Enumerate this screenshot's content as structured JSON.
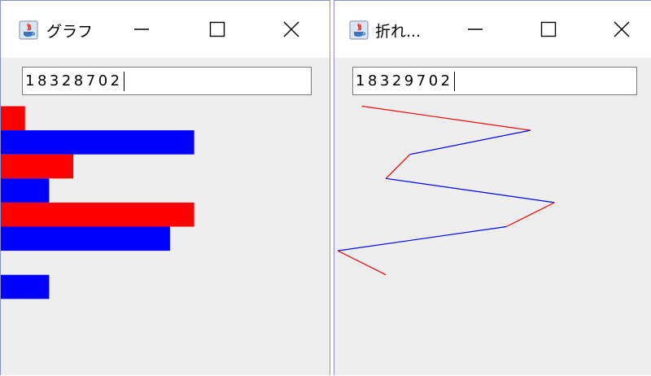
{
  "left_window": {
    "title": "グラフ",
    "input_value": "18328702"
  },
  "right_window": {
    "title": "折れ...",
    "input_value": "18329702"
  },
  "colors": {
    "red": "#ff0000",
    "blue": "#0000ff",
    "content_bg": "#eeeeee",
    "border": "#8b8fd0"
  },
  "chart_data": [
    {
      "type": "bar",
      "orientation": "horizontal",
      "values": [
        1,
        8,
        3,
        2,
        8,
        7,
        0,
        2
      ],
      "bar_colors": [
        "#ff0000",
        "#0000ff",
        "#ff0000",
        "#0000ff",
        "#ff0000",
        "#0000ff",
        "#ff0000",
        "#0000ff"
      ]
    },
    {
      "type": "line",
      "orientation": "vertical",
      "values": [
        1,
        8,
        3,
        2,
        9,
        7,
        0,
        2
      ],
      "segment_colors": [
        "#ff0000",
        "#0000ff",
        "#ff0000",
        "#0000ff",
        "#ff0000",
        "#0000ff",
        "#ff0000"
      ]
    }
  ],
  "icons": {
    "app": "java-icon",
    "minimize": "minimize-icon",
    "maximize": "maximize-icon",
    "close": "close-icon"
  }
}
